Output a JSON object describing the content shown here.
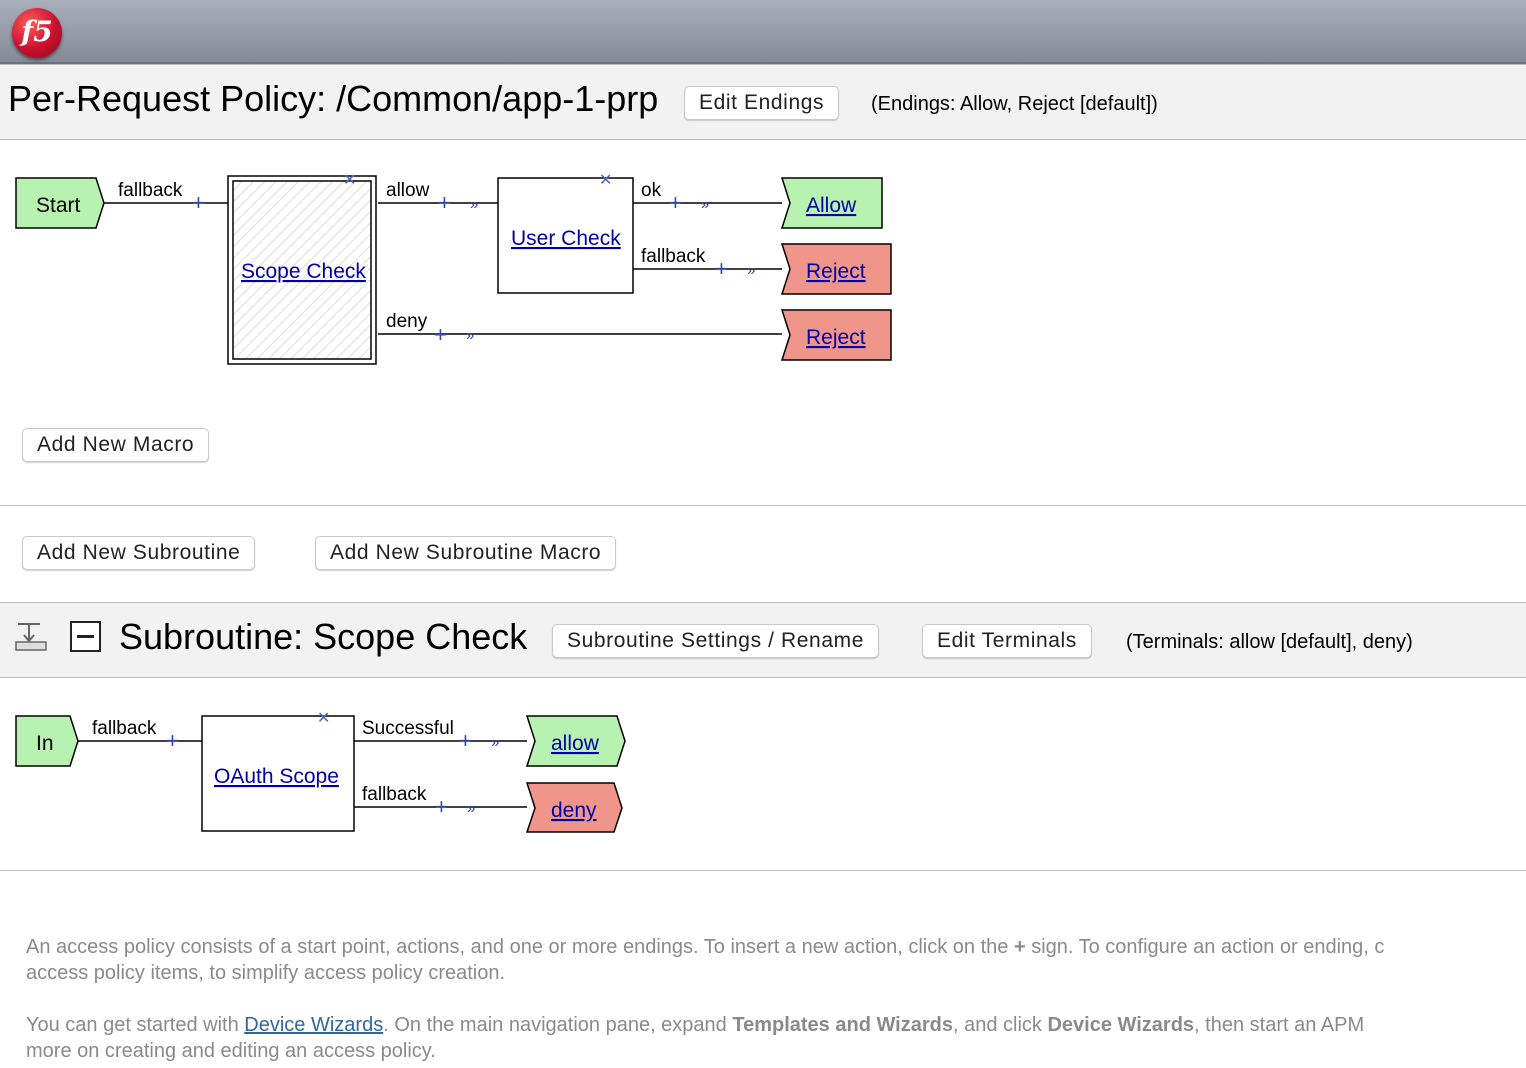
{
  "logo": {
    "text": "f5"
  },
  "policy": {
    "title": "Per-Request Policy: /Common/app-1-prp",
    "edit_endings_label": "Edit Endings",
    "endings_note": "(Endings: Allow, Reject [default])"
  },
  "main_flow": {
    "start_label": "Start",
    "start_branch": "fallback",
    "scope_check_label": "Scope Check",
    "scope_branches": [
      "allow",
      "deny"
    ],
    "user_check_label": "User Check",
    "user_branches": [
      "ok",
      "fallback"
    ],
    "endings": [
      "Allow",
      "Reject",
      "Reject"
    ]
  },
  "buttons": {
    "add_macro": "Add New Macro",
    "add_subroutine": "Add New Subroutine",
    "add_subroutine_macro": "Add New Subroutine Macro"
  },
  "subroutine": {
    "title": "Subroutine: Scope Check",
    "settings_label": "Subroutine Settings / Rename",
    "edit_terminals_label": "Edit Terminals",
    "terminals_note": "(Terminals: allow [default], deny)",
    "in_label": "In",
    "in_branch": "fallback",
    "oauth_label": "OAuth Scope",
    "oauth_branches": [
      "Successful",
      "fallback"
    ],
    "terminals": [
      "allow",
      "deny"
    ]
  },
  "help": {
    "line1": "An access policy consists of a start point, actions, and one or more endings. To insert a new action, click on the",
    "plus": "+",
    "line1b": "sign. To configure an action or ending, c",
    "line2": "access policy items, to simplify access policy creation.",
    "line3a": "You can get started with",
    "device_wizards_link": "Device Wizards",
    "line3b": ". On the main navigation pane, expand",
    "templates_bold": "Templates and Wizards",
    "line3c": ", and click",
    "device_wizards_bold": "Device Wizards",
    "line3d": ", then start an APM",
    "line4": "more on creating and editing an access policy."
  },
  "colors": {
    "start_fill": "#b8f2b0",
    "allow_fill": "#b8f2b0",
    "reject_fill": "#f0958a",
    "connector_plus": "#3344aa"
  }
}
